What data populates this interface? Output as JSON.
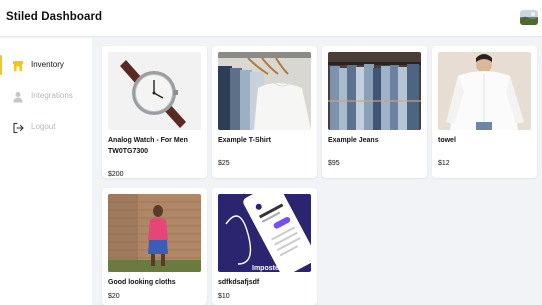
{
  "header": {
    "title": "Stiled Dashboard"
  },
  "sidebar": {
    "items": [
      {
        "label": "Inventory",
        "icon": "store-icon",
        "active": true
      },
      {
        "label": "Integrations",
        "icon": "user-icon",
        "active": false
      },
      {
        "label": "Logout",
        "icon": "logout-icon",
        "active": false
      }
    ]
  },
  "colors": {
    "accent": "#f5c518",
    "muted": "#b4b8be",
    "background": "#f1f3f6"
  },
  "products": [
    {
      "name": "Analog Watch - For Men TW0TG7300",
      "price": "$200",
      "image": "watch-image"
    },
    {
      "name": "Example T-Shirt",
      "price": "$25",
      "image": "tshirts-image"
    },
    {
      "name": "Example Jeans",
      "price": "$95",
      "image": "jeans-image"
    },
    {
      "name": "towel",
      "price": "$12",
      "image": "white-shirt-image"
    },
    {
      "name": "Good looking cloths",
      "price": "$20",
      "image": "woman-image"
    },
    {
      "name": "sdfkdsafjsdf",
      "price": "$10",
      "image": "imposter-app-image"
    }
  ],
  "imposter_text": "Imposter"
}
